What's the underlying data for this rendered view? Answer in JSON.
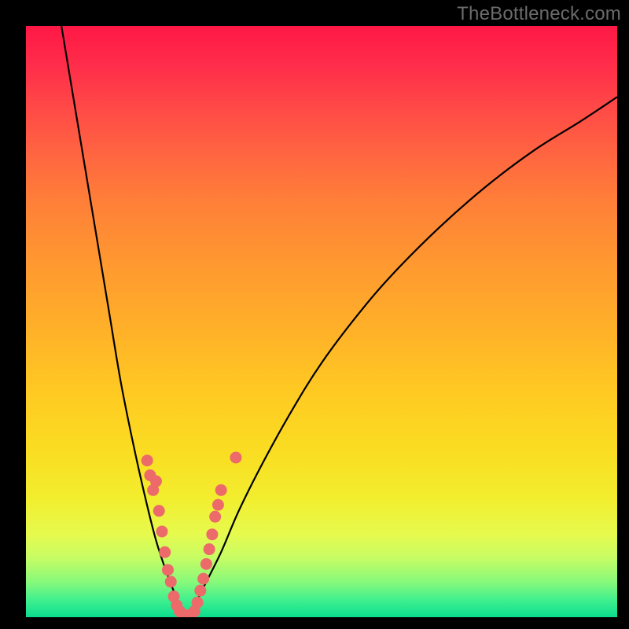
{
  "watermark": "TheBottleneck.com",
  "chart_data": {
    "type": "line",
    "title": "",
    "xlabel": "",
    "ylabel": "",
    "xlim": [
      0,
      100
    ],
    "ylim": [
      0,
      100
    ],
    "grid": false,
    "legend": false,
    "series": [
      {
        "name": "bottleneck-curve-left",
        "x": [
          6,
          8,
          10,
          12,
          14,
          16,
          18,
          20,
          22,
          24,
          26,
          27
        ],
        "y": [
          100,
          88,
          76,
          64,
          52,
          40,
          30,
          21,
          13,
          7,
          2,
          0
        ]
      },
      {
        "name": "bottleneck-curve-right",
        "x": [
          27,
          28,
          30,
          33,
          36,
          40,
          45,
          50,
          56,
          62,
          70,
          78,
          86,
          94,
          100
        ],
        "y": [
          0,
          1,
          5,
          11,
          18,
          26,
          35,
          43,
          51,
          58,
          66,
          73,
          79,
          84,
          88
        ]
      }
    ],
    "markers": {
      "name": "highlighted-points",
      "note": "salmon-colored data points clustered near the curve minimum",
      "points": [
        {
          "x": 20.5,
          "y": 26.5
        },
        {
          "x": 21.0,
          "y": 24.0
        },
        {
          "x": 21.5,
          "y": 21.5
        },
        {
          "x": 22.0,
          "y": 23.0
        },
        {
          "x": 22.5,
          "y": 18.0
        },
        {
          "x": 23.0,
          "y": 14.5
        },
        {
          "x": 23.5,
          "y": 11.0
        },
        {
          "x": 24.0,
          "y": 8.0
        },
        {
          "x": 24.5,
          "y": 6.0
        },
        {
          "x": 25.0,
          "y": 3.5
        },
        {
          "x": 25.5,
          "y": 2.0
        },
        {
          "x": 26.0,
          "y": 1.0
        },
        {
          "x": 26.5,
          "y": 0.5
        },
        {
          "x": 27.0,
          "y": 0.3
        },
        {
          "x": 27.5,
          "y": 0.3
        },
        {
          "x": 28.0,
          "y": 0.5
        },
        {
          "x": 28.5,
          "y": 1.0
        },
        {
          "x": 29.0,
          "y": 2.5
        },
        {
          "x": 29.5,
          "y": 4.5
        },
        {
          "x": 30.0,
          "y": 6.5
        },
        {
          "x": 30.5,
          "y": 9.0
        },
        {
          "x": 31.0,
          "y": 11.5
        },
        {
          "x": 31.5,
          "y": 14.0
        },
        {
          "x": 32.0,
          "y": 17.0
        },
        {
          "x": 32.5,
          "y": 19.0
        },
        {
          "x": 33.0,
          "y": 21.5
        },
        {
          "x": 35.5,
          "y": 27.0
        }
      ]
    }
  }
}
